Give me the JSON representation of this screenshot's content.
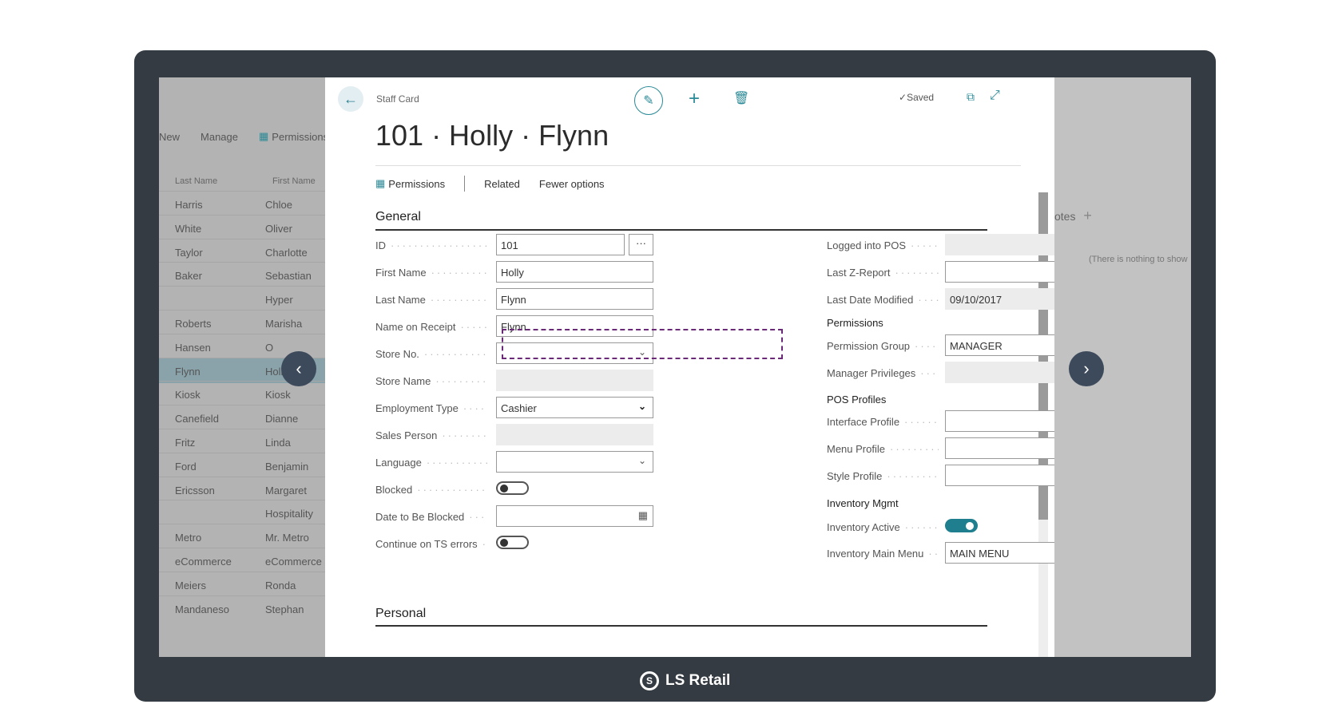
{
  "background_list": {
    "actions": [
      "New",
      "Manage",
      "Permissions"
    ],
    "columns": [
      "Last Name",
      "First Name"
    ],
    "rows": [
      {
        "last": "Harris",
        "first": "Chloe"
      },
      {
        "last": "White",
        "first": "Oliver"
      },
      {
        "last": "Taylor",
        "first": "Charlotte"
      },
      {
        "last": "Baker",
        "first": "Sebastian"
      },
      {
        "last": "",
        "first": "Hyper"
      },
      {
        "last": "Roberts",
        "first": "Marisha"
      },
      {
        "last": "Hansen",
        "first": "O"
      },
      {
        "last": "Flynn",
        "first": "Holly",
        "selected": true
      },
      {
        "last": "Kiosk",
        "first": "Kiosk"
      },
      {
        "last": "Canefield",
        "first": "Dianne"
      },
      {
        "last": "Fritz",
        "first": "Linda"
      },
      {
        "last": "Ford",
        "first": "Benjamin"
      },
      {
        "last": "Ericsson",
        "first": "Margaret"
      },
      {
        "last": "",
        "first": "Hospitality"
      },
      {
        "last": "Metro",
        "first": "Mr. Metro"
      },
      {
        "last": "eCommerce",
        "first": "eCommerce"
      },
      {
        "last": "Meiers",
        "first": "Ronda"
      },
      {
        "last": "Mandaneso",
        "first": "Stephan"
      }
    ]
  },
  "background_right": {
    "notes_label": "otes",
    "nothing_text": "(There is nothing to show"
  },
  "card": {
    "label": "Staff Card",
    "title": "101 · Holly · Flynn",
    "saved": "Saved",
    "menu": {
      "permissions": "Permissions",
      "related": "Related",
      "fewer": "Fewer options"
    },
    "general_title": "General",
    "personal_title": "Personal",
    "left_fields": [
      {
        "label": "ID",
        "value": "101",
        "kind": "lookup"
      },
      {
        "label": "First Name",
        "value": "Holly",
        "kind": "text"
      },
      {
        "label": "Last Name",
        "value": "Flynn",
        "kind": "text"
      },
      {
        "label": "Name on Receipt",
        "value": "Flynn",
        "kind": "text"
      },
      {
        "label": "Store No.",
        "value": "",
        "kind": "dropdown"
      },
      {
        "label": "Store Name",
        "value": "",
        "kind": "readonly"
      },
      {
        "label": "Employment Type",
        "value": "Cashier",
        "kind": "select"
      },
      {
        "label": "Sales Person",
        "value": "",
        "kind": "readonly"
      },
      {
        "label": "Language",
        "value": "",
        "kind": "dropdown"
      },
      {
        "label": "Blocked",
        "value": "",
        "kind": "toggle-off"
      },
      {
        "label": "Date to Be Blocked",
        "value": "",
        "kind": "date"
      },
      {
        "label": "Continue on TS errors",
        "value": "",
        "kind": "toggle-off"
      }
    ],
    "right_top": [
      {
        "label": "Logged into POS",
        "value": "",
        "kind": "readonly"
      },
      {
        "label": "Last Z-Report",
        "value": "",
        "kind": "text"
      },
      {
        "label": "Last Date Modified",
        "value": "09/10/2017",
        "kind": "readonly"
      }
    ],
    "permissions_title": "Permissions",
    "permission_group": {
      "label": "Permission Group",
      "value": "MANAGER"
    },
    "manager_privileges": {
      "label": "Manager Privileges",
      "value": ""
    },
    "pos_profiles_title": "POS Profiles",
    "pos_profiles": [
      {
        "label": "Interface Profile",
        "value": ""
      },
      {
        "label": "Menu Profile",
        "value": ""
      },
      {
        "label": "Style Profile",
        "value": ""
      }
    ],
    "inventory_title": "Inventory Mgmt",
    "inventory_active": {
      "label": "Inventory Active",
      "on": true
    },
    "inventory_main_menu": {
      "label": "Inventory Main Menu",
      "value": "MAIN MENU"
    }
  },
  "brand": "LS Retail",
  "colors": {
    "accent": "#2a8a97",
    "frame": "#353b42",
    "highlight": "#6b2a78",
    "nav": "#3c4a5b"
  }
}
